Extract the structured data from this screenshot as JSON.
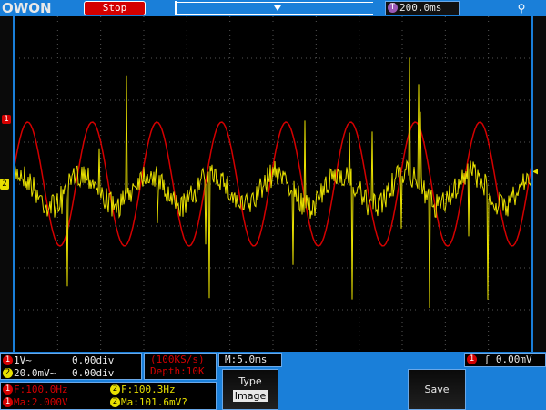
{
  "header": {
    "logo": "OWON",
    "run_status": "Stop",
    "timebase_badge": "T",
    "timebase": "200.0ms"
  },
  "channels": {
    "ch1": {
      "number": "1",
      "coupling": "1V~",
      "offset": "0.00div",
      "color": "#d40000"
    },
    "ch2": {
      "number": "2",
      "coupling": "20.0mV~",
      "offset": "0.00div",
      "color": "#e8e000"
    }
  },
  "sample": {
    "rate": "(100KS/s)",
    "depth": "Depth:10K"
  },
  "main_timebase": "M:5.0ms",
  "trigger": {
    "badge": "1",
    "edge_symbol": "ʃ",
    "level": "0.00mV"
  },
  "measurements": {
    "ch1_freq": "F:100.0Hz",
    "ch2_freq": "F:100.3Hz",
    "ch1_amp": "Ma:2.000V",
    "ch2_amp": "Ma:101.6mV?"
  },
  "menu": {
    "type_label": "Type",
    "type_value": "Image",
    "save_label": "Save"
  },
  "icons": {
    "usb": "usb-icon",
    "trigger_marker": "trigger-level-marker"
  }
}
